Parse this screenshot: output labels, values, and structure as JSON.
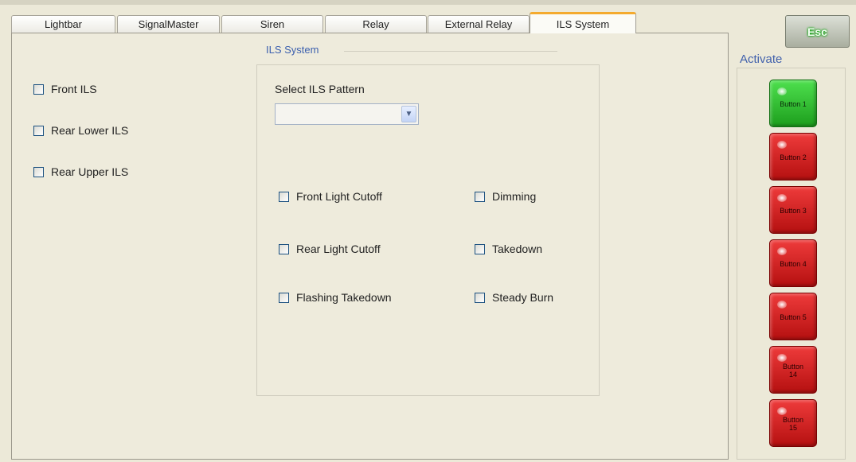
{
  "tabs": [
    "Lightbar",
    "SignalMaster",
    "Siren",
    "Relay",
    "External Relay",
    "ILS System"
  ],
  "active_tab": "ILS System",
  "left_options": [
    "Front ILS",
    "Rear Lower ILS",
    "Rear Upper ILS"
  ],
  "group": {
    "title": "ILS System",
    "select_label": "Select ILS Pattern",
    "select_value": "",
    "options_left": [
      "Front Light Cutoff",
      "Rear Light Cutoff",
      "Flashing Takedown"
    ],
    "options_right": [
      "Dimming",
      "Takedown",
      "Steady Burn"
    ]
  },
  "esc_label": "Esc",
  "activate": {
    "title": "Activate",
    "buttons": [
      {
        "label": "Button 1",
        "state": "green"
      },
      {
        "label": "Button 2",
        "state": "red"
      },
      {
        "label": "Button 3",
        "state": "red"
      },
      {
        "label": "Button 4",
        "state": "red"
      },
      {
        "label": "Button 5",
        "state": "red"
      },
      {
        "label": "Button 14",
        "state": "red"
      },
      {
        "label": "Button 15",
        "state": "red"
      }
    ]
  },
  "colors": {
    "green": "#2fc02f",
    "red": "#d01b1b",
    "tab_accent": "#f4aa2d",
    "group_title": "#3b5fae"
  }
}
